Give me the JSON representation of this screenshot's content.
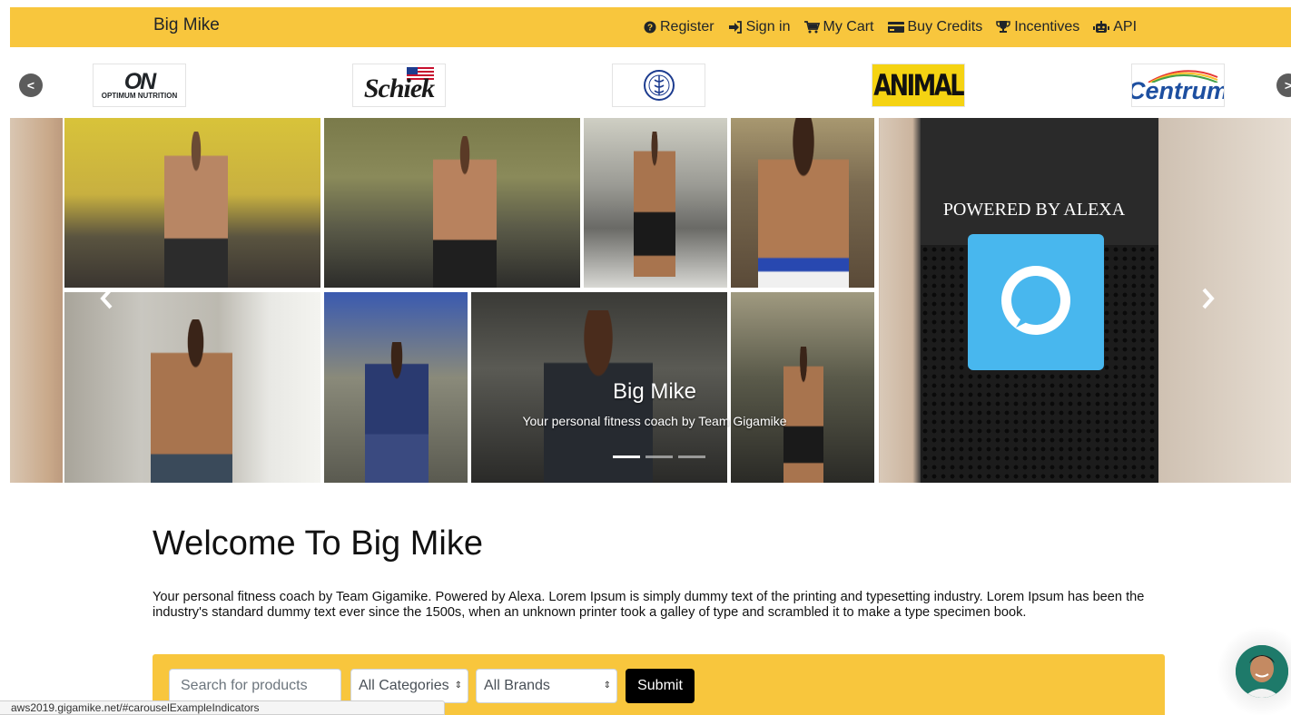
{
  "navbar": {
    "brand": "Big Mike",
    "links": [
      {
        "label": "Register",
        "icon": "question-circle-icon"
      },
      {
        "label": "Sign in",
        "icon": "sign-in-icon"
      },
      {
        "label": "My Cart",
        "icon": "cart-icon"
      },
      {
        "label": "Buy Credits",
        "icon": "credit-card-icon"
      },
      {
        "label": "Incentives",
        "icon": "trophy-icon"
      },
      {
        "label": "API",
        "icon": "robot-icon"
      }
    ],
    "color": "#f8c63d"
  },
  "brand_strip": {
    "prev": "<",
    "next": ">",
    "logos": [
      {
        "name": "ON",
        "sub": "OPTIMUM NUTRITION"
      },
      {
        "name": "Schiek"
      },
      {
        "name": "emblem"
      },
      {
        "name": "ANIMAL"
      },
      {
        "name": "Centrum"
      }
    ]
  },
  "carousel": {
    "alexa_title": "POWERED BY ALEXA",
    "caption_title": "Big Mike",
    "caption_text": "Your personal fitness coach by Team Gigamike",
    "prev_icon": "chevron-left-icon",
    "next_icon": "chevron-right-icon",
    "active_slide": 1,
    "slide_count": 3
  },
  "welcome": {
    "title": "Welcome To Big Mike",
    "text": "Your personal fitness coach by Team Gigamike. Powered by Alexa. Lorem Ipsum is simply dummy text of the printing and typesetting industry. Lorem Ipsum has been the industry's standard dummy text ever since the 1500s, when an unknown printer took a galley of type and scrambled it to make a type specimen book."
  },
  "search": {
    "placeholder": "Search for products",
    "category": "All Categories",
    "brand": "All Brands",
    "submit": "Submit"
  },
  "status_bar": {
    "url": "aws2019.gigamike.net/#carouselExampleIndicators"
  }
}
